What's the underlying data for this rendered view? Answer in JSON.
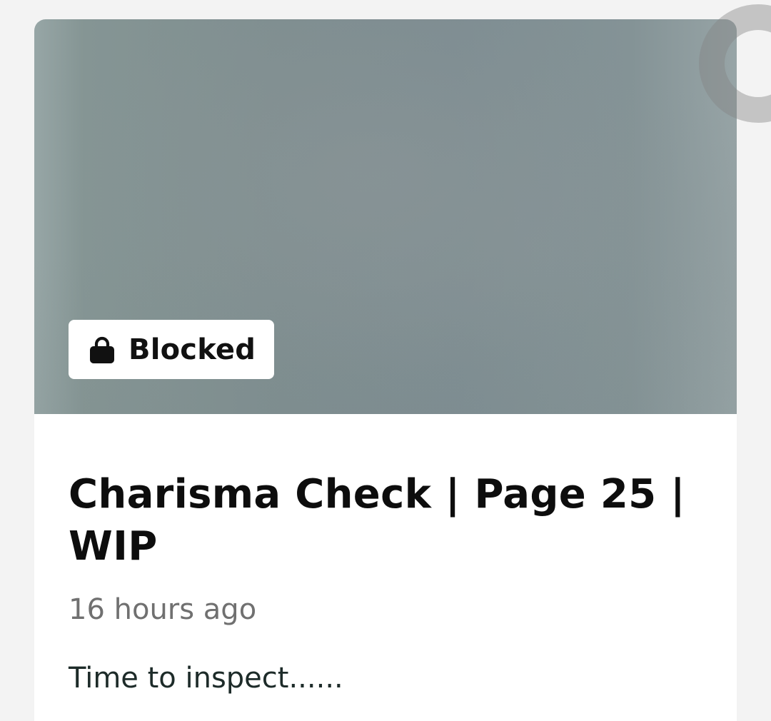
{
  "post": {
    "badge_label": "Blocked",
    "badge_icon": "lock-icon",
    "title": "Charisma Check | Page 25 | WIP",
    "timestamp": "16 hours ago",
    "excerpt": "Time to inspect......"
  },
  "loading_indicator": {
    "icon": "spinner-icon",
    "color": "#9a9a9a"
  }
}
